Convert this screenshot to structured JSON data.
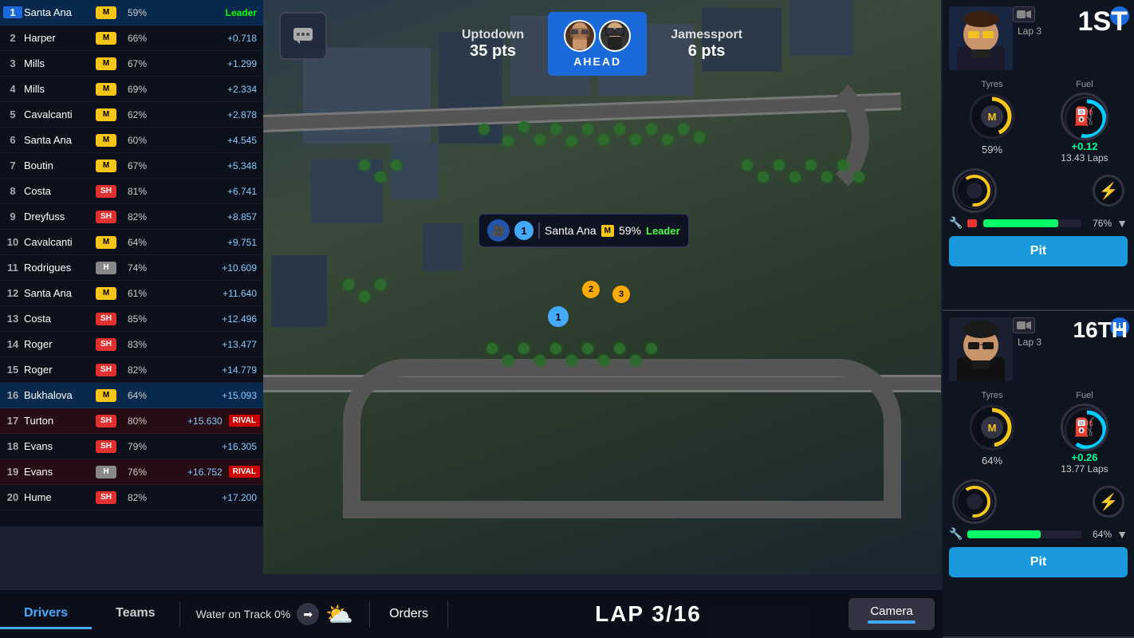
{
  "leaderboard": {
    "rows": [
      {
        "pos": 1,
        "name": "Santa Ana",
        "tyre": "M",
        "tyre_class": "tyre-m",
        "wear": "59%",
        "gap": "Leader",
        "gap_class": "gap-leader",
        "highlighted": true,
        "rival": false
      },
      {
        "pos": 2,
        "name": "Harper",
        "tyre": "M",
        "tyre_class": "tyre-m",
        "wear": "66%",
        "gap": "+0.718",
        "gap_class": "",
        "highlighted": false,
        "rival": false
      },
      {
        "pos": 3,
        "name": "Mills",
        "tyre": "M",
        "tyre_class": "tyre-m",
        "wear": "67%",
        "gap": "+1.299",
        "gap_class": "",
        "highlighted": false,
        "rival": false
      },
      {
        "pos": 4,
        "name": "Mills",
        "tyre": "M",
        "tyre_class": "tyre-m",
        "wear": "69%",
        "gap": "+2.334",
        "gap_class": "",
        "highlighted": false,
        "rival": false
      },
      {
        "pos": 5,
        "name": "Cavalcanti",
        "tyre": "M",
        "tyre_class": "tyre-m",
        "wear": "62%",
        "gap": "+2.878",
        "gap_class": "",
        "highlighted": false,
        "rival": false
      },
      {
        "pos": 6,
        "name": "Santa Ana",
        "tyre": "M",
        "tyre_class": "tyre-m",
        "wear": "60%",
        "gap": "+4.545",
        "gap_class": "",
        "highlighted": false,
        "rival": false
      },
      {
        "pos": 7,
        "name": "Boutin",
        "tyre": "M",
        "tyre_class": "tyre-m",
        "wear": "67%",
        "gap": "+5.348",
        "gap_class": "",
        "highlighted": false,
        "rival": false
      },
      {
        "pos": 8,
        "name": "Costa",
        "tyre": "SH",
        "tyre_class": "tyre-sh",
        "wear": "81%",
        "gap": "+6.741",
        "gap_class": "",
        "highlighted": false,
        "rival": false
      },
      {
        "pos": 9,
        "name": "Dreyfuss",
        "tyre": "SH",
        "tyre_class": "tyre-sh",
        "wear": "82%",
        "gap": "+8.857",
        "gap_class": "",
        "highlighted": false,
        "rival": false
      },
      {
        "pos": 10,
        "name": "Cavalcanti",
        "tyre": "M",
        "tyre_class": "tyre-m",
        "wear": "64%",
        "gap": "+9.751",
        "gap_class": "",
        "highlighted": false,
        "rival": false
      },
      {
        "pos": 11,
        "name": "Rodrigues",
        "tyre": "H",
        "tyre_class": "tyre-h",
        "wear": "74%",
        "gap": "+10.609",
        "gap_class": "",
        "highlighted": false,
        "rival": false
      },
      {
        "pos": 12,
        "name": "Santa Ana",
        "tyre": "M",
        "tyre_class": "tyre-m",
        "wear": "61%",
        "gap": "+11.640",
        "gap_class": "",
        "highlighted": false,
        "rival": false
      },
      {
        "pos": 13,
        "name": "Costa",
        "tyre": "SH",
        "tyre_class": "tyre-sh",
        "wear": "85%",
        "gap": "+12.496",
        "gap_class": "",
        "highlighted": false,
        "rival": false
      },
      {
        "pos": 14,
        "name": "Roger",
        "tyre": "SH",
        "tyre_class": "tyre-sh",
        "wear": "83%",
        "gap": "+13.477",
        "gap_class": "",
        "highlighted": false,
        "rival": false
      },
      {
        "pos": 15,
        "name": "Roger",
        "tyre": "SH",
        "tyre_class": "tyre-sh",
        "wear": "82%",
        "gap": "+14.779",
        "gap_class": "",
        "highlighted": false,
        "rival": false
      },
      {
        "pos": 16,
        "name": "Bukhalova",
        "tyre": "M",
        "tyre_class": "tyre-m",
        "wear": "64%",
        "gap": "+15.093",
        "gap_class": "",
        "highlighted": true,
        "rival": false
      },
      {
        "pos": 17,
        "name": "Turton",
        "tyre": "SH",
        "tyre_class": "tyre-sh",
        "wear": "80%",
        "gap": "+15.630",
        "gap_class": "",
        "highlighted": false,
        "rival": true
      },
      {
        "pos": 18,
        "name": "Evans",
        "tyre": "SH",
        "tyre_class": "tyre-sh",
        "wear": "79%",
        "gap": "+16.305",
        "gap_class": "",
        "highlighted": false,
        "rival": false
      },
      {
        "pos": 19,
        "name": "Evans",
        "tyre": "H",
        "tyre_class": "tyre-h",
        "wear": "76%",
        "gap": "+16.752",
        "gap_class": "",
        "highlighted": false,
        "rival": true
      },
      {
        "pos": 20,
        "name": "Hume",
        "tyre": "SH",
        "tyre_class": "tyre-sh",
        "wear": "82%",
        "gap": "+17.200",
        "gap_class": "",
        "highlighted": false,
        "rival": false
      }
    ]
  },
  "hud": {
    "team_left": "Uptodown",
    "pts_left": "35 pts",
    "ahead_label": "AHEAD",
    "team_right": "Jamessport",
    "pts_right": "6 pts"
  },
  "tooltip": {
    "pos": "1",
    "driver": "Santa Ana",
    "tyre": "M",
    "wear": "59%",
    "status": "Leader"
  },
  "driver1": {
    "lap": "Lap 3",
    "position": "1ST",
    "tyres_label": "Tyres",
    "fuel_label": "Fuel",
    "tyre_pct": "59%",
    "fuel_plus": "+0.12",
    "fuel_laps": "13.43 Laps",
    "repair_pct": "76%",
    "pit_label": "Pit"
  },
  "driver2": {
    "lap": "Lap 3",
    "position": "16TH",
    "tyres_label": "Tyres",
    "fuel_label": "Fuel",
    "tyre_pct": "64%",
    "fuel_plus": "+0.26",
    "fuel_laps": "13.77 Laps",
    "repair_pct": "64%",
    "pit_label": "Pit"
  },
  "bottom": {
    "tab_drivers": "Drivers",
    "tab_teams": "Teams",
    "water": "Water on Track  0%",
    "orders": "Orders",
    "lap": "LAP 3/16",
    "camera": "Camera"
  }
}
